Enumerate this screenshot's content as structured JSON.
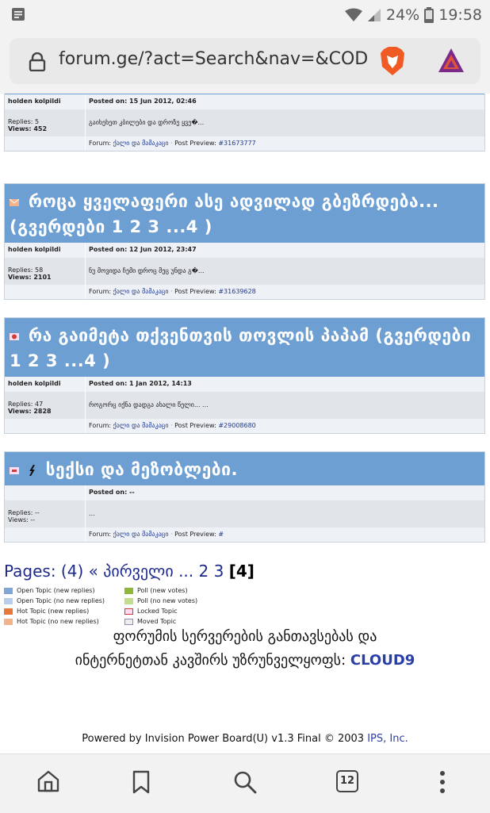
{
  "status": {
    "battery": "24%",
    "time": "19:58"
  },
  "browser": {
    "url": "forum.ge/?act=Search&nav=&CODE=",
    "tabs_count": "12"
  },
  "topics": [
    {
      "title": "",
      "author": "holden kolpildi",
      "posted": "Posted on: 15 Jun 2012, 02:46",
      "replies": "Replies: 5",
      "views": "Views: 452",
      "preview": "გაიხეხეთ კბილები და დროზე ყვე�...",
      "forum_label": "Forum:",
      "forum_name": "ქალი და მამაკაცი",
      "post_preview_label": "Post Preview:",
      "post_preview_id": "#31673777"
    },
    {
      "title": "როცა ყველაფერი ასე ადვილად გბეზრდება... (გვერდები 1 2 3 ...4 )",
      "author": "holden kolpildi",
      "posted": "Posted on: 12 Jun 2012, 23:47",
      "replies": "Replies: 58",
      "views": "Views: 2101",
      "preview": "ნუ მოვიდა ჩემი დროც მეც უნდა გ�...",
      "forum_label": "Forum:",
      "forum_name": "ქალი და მამაკაცი",
      "post_preview_label": "Post Preview:",
      "post_preview_id": "#31639628"
    },
    {
      "title": "რა გაიმეტა თქვენთვის თოვლის პაპამ (გვერდები 1 2 3 ...4 )",
      "author": "holden kolpildi",
      "posted": "Posted on: 1 Jan 2012, 14:13",
      "replies": "Replies: 47",
      "views": "Views: 2828",
      "preview": "როგორც იქნა დადგა ახალი წელი... ...",
      "forum_label": "Forum:",
      "forum_name": "ქალი და მამაკაცი",
      "post_preview_label": "Post Preview:",
      "post_preview_id": "#29008680"
    },
    {
      "title": "სექსი და მეზობლები.",
      "author": "",
      "posted": "Posted on: --",
      "replies": "Replies: --",
      "views": "Views: --",
      "preview": "...",
      "forum_label": "Forum:",
      "forum_name": "ქალი და მამაკაცი",
      "post_preview_label": "Post Preview:",
      "post_preview_id": "#"
    }
  ],
  "pagination": {
    "label": "Pages: (4)",
    "first": "« პირველი",
    "ellipsis": "...",
    "p2": "2",
    "p3": "3",
    "current": "[4]"
  },
  "legend": [
    {
      "label": "Open Topic (new replies)",
      "color": "#7fa6d6"
    },
    {
      "label": "Open Topic (no new replies)",
      "color": "#b7cde9"
    },
    {
      "label": "Hot Topic (new replies)",
      "color": "#e8773a"
    },
    {
      "label": "Hot Topic (no new replies)",
      "color": "#f2b38c"
    },
    {
      "label": "Poll (new votes)",
      "color": "#8fb83a"
    },
    {
      "label": "Poll (no new votes)",
      "color": "#c4dc8e"
    },
    {
      "label": "Locked Topic",
      "color": "#d23a3a"
    },
    {
      "label": "Moved Topic",
      "color": "#9a7fc9"
    }
  ],
  "hosting": {
    "line1": "ფორუმის სერვერების განთავსებას და",
    "line2": "ინტერნეტთან კავშირს უზრუნველყოფს:",
    "brand": "CLOUD9"
  },
  "footer": {
    "powered": "Powered by Invision Power Board(U) v1.3 Final © 2003",
    "ips": "IPS, Inc."
  }
}
